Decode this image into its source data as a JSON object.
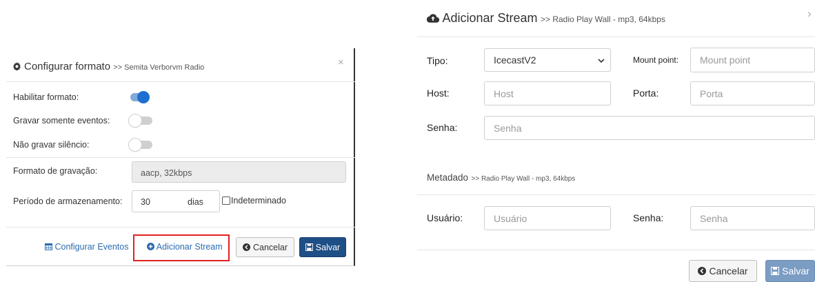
{
  "left_modal": {
    "title": "Configurar formato",
    "subtitle": ">> Semita Verborvm Radio",
    "close": "×",
    "rows": {
      "habilitar": {
        "label": "Habilitar formato:",
        "on": true
      },
      "gravar_eventos": {
        "label": "Gravar somente eventos:",
        "on": false
      },
      "nao_gravar": {
        "label": "Não gravar silêncio:",
        "on": false
      }
    },
    "formato": {
      "label": "Formato de gravação:",
      "value": "aacp, 32kbps"
    },
    "periodo": {
      "label": "Período de armazenamento:",
      "value": "30",
      "unit": "dias",
      "checkbox_label": "Indeterminado"
    },
    "footer": {
      "configurar_eventos": "Configurar Eventos",
      "adicionar_stream": "Adicionar Stream",
      "cancelar": "Cancelar",
      "salvar": "Salvar"
    },
    "highlight_color": "#e02020"
  },
  "right_panel": {
    "title": "Adicionar Stream",
    "subtitle": ">> Radio Play Wall - mp3, 64kbps",
    "close": "›",
    "tipo": {
      "label": "Tipo:",
      "value": "IcecastV2"
    },
    "mount": {
      "label": "Mount point:",
      "placeholder": "Mount point"
    },
    "host": {
      "label": "Host:",
      "placeholder": "Host"
    },
    "porta": {
      "label": "Porta:",
      "placeholder": "Porta"
    },
    "senha": {
      "label": "Senha:",
      "placeholder": "Senha"
    },
    "metadado": {
      "title": "Metadado",
      "subtitle": ">> Radio Play Wall - mp3, 64kbps"
    },
    "usuario": {
      "label": "Usuário:",
      "placeholder": "Usuário"
    },
    "senha2": {
      "label": "Senha:",
      "placeholder": "Senha"
    },
    "footer": {
      "cancelar": "Cancelar",
      "salvar": "Salvar"
    }
  }
}
